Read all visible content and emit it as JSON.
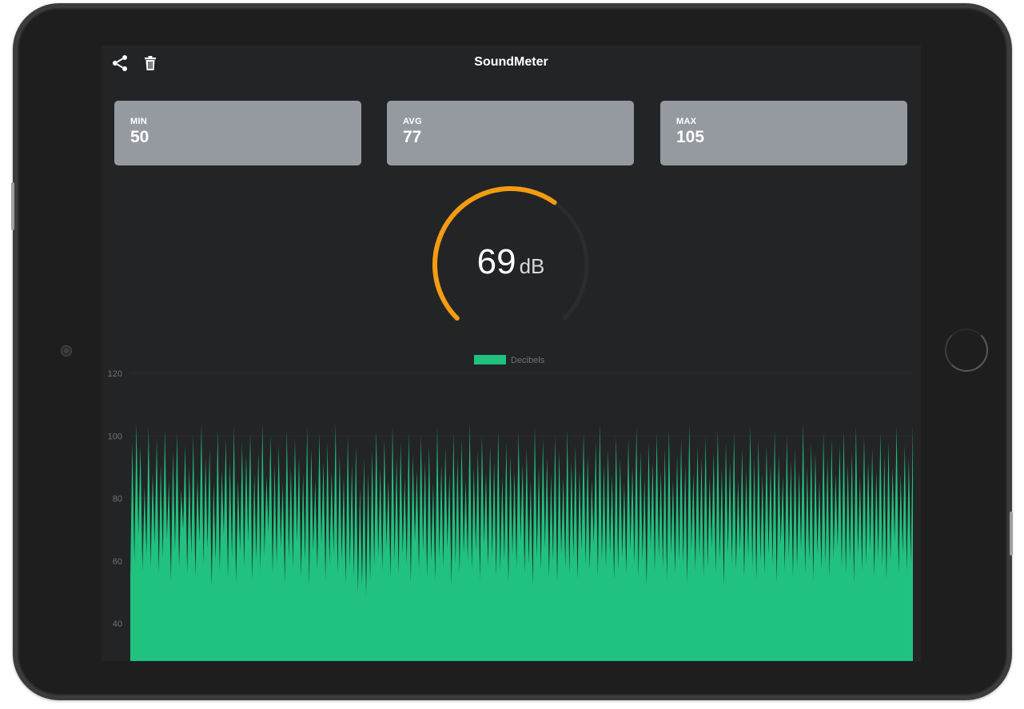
{
  "app": {
    "title": "SoundMeter"
  },
  "toolbar": {
    "share_icon": "share-icon",
    "delete_icon": "trash-icon"
  },
  "stats": [
    {
      "label": "MIN",
      "value": "50"
    },
    {
      "label": "AVG",
      "value": "77"
    },
    {
      "label": "MAX",
      "value": "105"
    }
  ],
  "gauge": {
    "value": "69",
    "unit": "dB",
    "level": 69,
    "max": 120,
    "color": "#f39c12"
  },
  "chart_data": {
    "type": "area",
    "title": "",
    "xlabel": "",
    "ylabel": "",
    "legend": {
      "label": "Decibels",
      "position": "top-center"
    },
    "color": "#21c17f",
    "ylim": [
      28,
      120
    ],
    "yticks": [
      40,
      60,
      80,
      100,
      120
    ],
    "grid": true,
    "series": [
      {
        "name": "Decibels",
        "values": [
          55,
          98,
          60,
          104,
          68,
          97,
          57,
          84,
          62,
          103,
          58,
          88,
          65,
          99,
          56,
          91,
          61,
          102,
          67,
          86,
          54,
          95,
          63,
          101,
          58,
          83,
          70,
          97,
          56,
          90,
          62,
          100,
          55,
          87,
          66,
          104,
          59,
          93,
          64,
          96,
          52,
          85,
          60,
          102,
          57,
          89,
          68,
          99,
          55,
          92,
          61,
          103,
          53,
          86,
          63,
          98,
          58,
          94,
          66,
          101,
          54,
          88,
          60,
          95,
          57,
          104,
          62,
          87,
          69,
          100,
          56,
          91,
          59,
          97,
          64,
          85,
          53,
          102,
          61,
          90,
          58,
          99,
          66,
          93,
          55,
          88,
          60,
          103,
          52,
          96,
          63,
          86,
          57,
          101,
          65,
          92,
          54,
          98,
          59,
          89,
          62,
          104,
          56,
          94,
          60,
          87,
          53,
          100,
          58,
          91,
          55,
          97,
          50,
          84,
          52,
          93,
          49,
          88,
          54,
          95,
          58,
          102,
          61,
          90,
          57,
          99,
          64,
          86,
          55,
          103,
          60,
          93,
          56,
          98,
          62,
          87,
          59,
          101,
          53,
          94,
          66,
          89,
          57,
          100,
          63,
          92,
          55,
          97,
          60,
          85,
          54,
          103,
          61,
          91,
          58,
          96,
          64,
          88,
          52,
          101,
          59,
          93,
          56,
          99,
          62,
          86,
          60,
          104,
          57,
          90,
          63,
          95,
          54,
          100,
          65,
          88,
          58,
          97,
          61,
          92,
          55,
          102,
          57,
          87,
          60,
          98,
          53,
          94,
          62,
          89,
          58,
          101,
          66,
          91,
          56,
          96,
          59,
          86,
          52,
          103,
          61,
          90,
          57,
          99,
          64,
          93,
          55,
          88,
          60,
          100,
          53,
          95,
          62,
          87,
          58,
          102,
          56,
          92,
          61,
          97,
          54,
          89,
          63,
          101,
          59,
          94,
          57,
          86,
          65,
          98,
          55,
          104,
          60,
          91,
          58,
          96,
          62,
          88,
          54,
          100,
          57,
          93,
          61,
          85,
          56,
          99,
          63,
          90,
          59,
          103,
          55,
          95,
          60,
          87,
          52,
          98,
          64,
          92,
          57,
          101,
          61,
          89,
          58,
          96,
          54,
          102,
          62,
          86,
          56,
          94,
          60,
          99,
          59,
          91,
          53,
          104,
          63,
          88,
          57,
          97,
          61,
          93,
          55,
          100,
          58,
          87,
          64,
          95,
          56,
          102,
          60,
          90,
          52,
          98,
          62,
          92,
          59,
          101,
          57,
          86,
          63,
          96,
          55,
          89,
          61,
          103,
          58,
          93,
          54,
          99,
          60,
          88,
          56,
          97,
          62,
          91,
          59,
          102,
          53,
          94,
          65,
          87,
          57,
          100,
          61,
          92,
          55,
          96,
          58,
          89,
          63,
          104,
          56,
          90,
          60,
          98,
          54,
          95,
          62,
          86,
          57,
          101,
          59,
          93,
          55,
          99,
          61,
          88,
          64,
          97,
          58,
          102,
          56,
          91,
          60,
          95,
          53,
          103,
          62,
          87,
          57,
          100,
          59,
          92,
          63,
          96,
          55,
          89,
          61,
          101,
          58,
          94,
          54,
          98,
          60,
          90,
          66,
          103,
          56,
          88,
          62,
          97,
          57,
          93,
          59,
          104
        ]
      }
    ]
  }
}
